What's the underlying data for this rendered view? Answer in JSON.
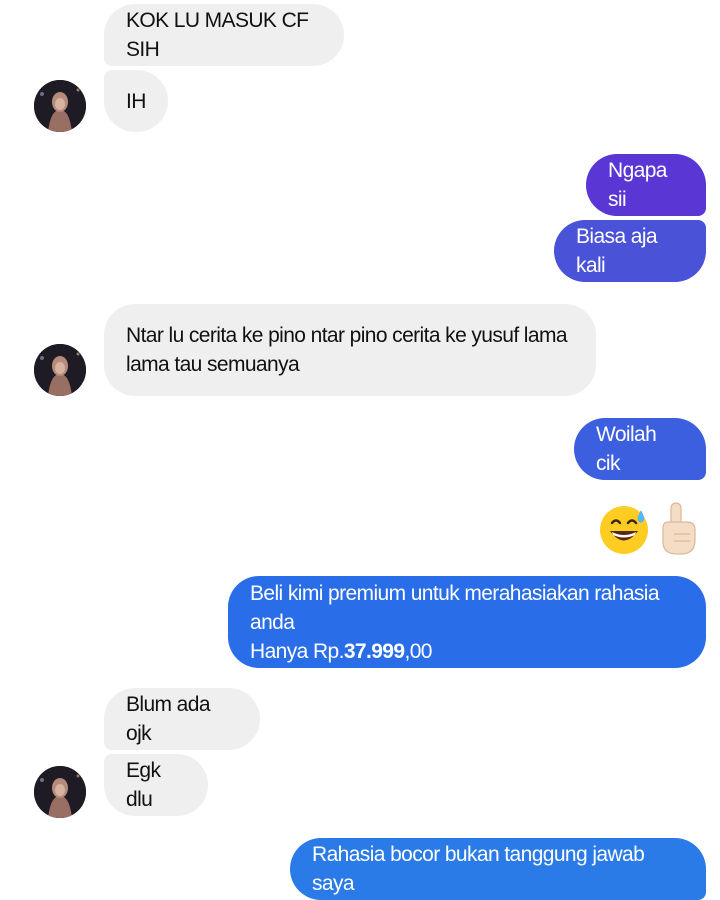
{
  "colors": {
    "incoming_bg": "#efefef",
    "outgoing_purple": "#5a37d4",
    "outgoing_indigo": "#4a52d8",
    "outgoing_blue": "#2a6de8"
  },
  "messages": [
    {
      "side": "in",
      "text": "KOK LU MASUK CF SIH"
    },
    {
      "side": "in",
      "text": "IH"
    },
    {
      "side": "out",
      "text": "Ngapa sii"
    },
    {
      "side": "out",
      "text": "Biasa aja kali"
    },
    {
      "side": "in",
      "line1": "Ntar lu cerita ke pino ntar pino cerita ke yusuf lama",
      "line2": "lama tau semuanya"
    },
    {
      "side": "out",
      "text": "Woilah cik"
    },
    {
      "side": "out",
      "emoji": [
        "grinning-face-with-sweat",
        "index-pointing-up"
      ]
    },
    {
      "side": "out",
      "line1": "Beli kimi premium untuk merahasiakan rahasia anda",
      "line2_prefix": "Hanya Rp.",
      "line2_bold": "37.999",
      "line2_suffix": ",00"
    },
    {
      "side": "in",
      "text": "Blum ada ojk"
    },
    {
      "side": "in",
      "text": "Egk dlu"
    },
    {
      "side": "out",
      "text": "Rahasia bocor bukan tanggung jawab saya"
    }
  ]
}
